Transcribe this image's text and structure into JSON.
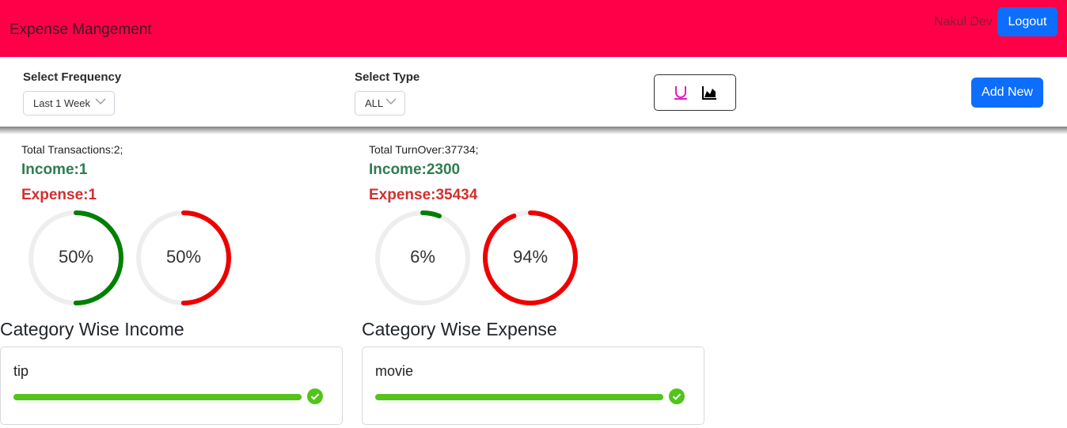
{
  "header": {
    "brand": "Expense Mangement",
    "user": "Nakul Dev",
    "logout_label": "Logout",
    "bg_color": "#ff0048"
  },
  "filters": {
    "frequency_label": "Select Frequency",
    "frequency_value": "Last 1 Week",
    "type_label": "Select Type",
    "type_value": "ALL",
    "list_view_icon": "underline-list-icon",
    "chart_view_icon": "area-chart-icon",
    "add_new_label": "Add New"
  },
  "transactions": {
    "total": "Total Transactions:2;",
    "income": "Income:1",
    "expense": "Expense:1",
    "income_pct": 50,
    "expense_pct": 50,
    "income_pct_label": "50%",
    "expense_pct_label": "50%"
  },
  "turnover": {
    "total": "Total TurnOver:37734;",
    "income": "Income:2300",
    "expense": "Expense:35434",
    "income_pct": 6,
    "expense_pct": 94,
    "income_pct_label": "6%",
    "expense_pct_label": "94%"
  },
  "colors": {
    "income_ring": "#008000",
    "expense_ring": "#ee0000",
    "ring_track": "#eeeeee",
    "progress": "#52c41a"
  },
  "category_income": {
    "title": "Category Wise Income",
    "items": [
      {
        "name": "tip",
        "progress": 100
      }
    ]
  },
  "category_expense": {
    "title": "Category Wise Expense",
    "items": [
      {
        "name": "movie",
        "progress": 100
      }
    ]
  }
}
